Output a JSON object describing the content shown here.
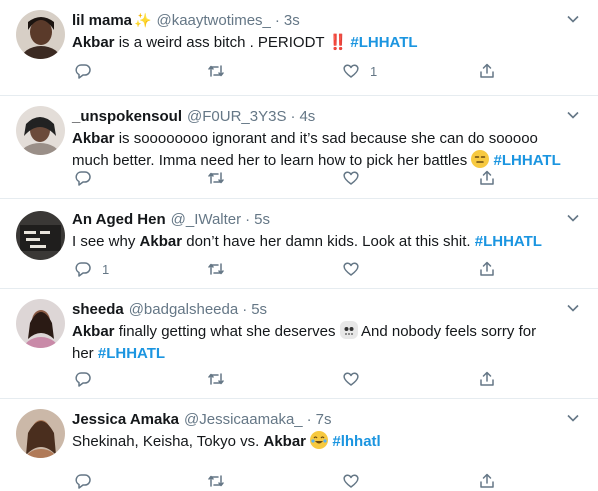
{
  "tweets": [
    {
      "name": "lil mama",
      "handle": "@kaaytwotimes_",
      "dot": "·",
      "time": "3s",
      "mention": "Akbar",
      "text_lines": [
        " is a weird ass bitch . PERIODT "
      ],
      "hashtag": "#LHHATL",
      "reply_count": "",
      "like_count": "1"
    },
    {
      "name": "_unspokensoul",
      "handle": "@F0UR_3Y3S",
      "dot": "·",
      "time": "4s",
      "mention": "Akbar",
      "text_lines": [
        " is soooooooo ignorant and it’s sad because she can do sooooo",
        "much better. Imma need her to learn how to pick her battles "
      ],
      "hashtag": "#LHHATL",
      "reply_count": "",
      "like_count": ""
    },
    {
      "name": "An Aged Hen",
      "handle": "@_IWalter",
      "dot": "·",
      "time": "5s",
      "text_pre": "I see why ",
      "mention": "Akbar",
      "text_lines": [
        " don’t have her damn kids. Look at this shit. "
      ],
      "hashtag": "#LHHATL",
      "reply_count": "1",
      "like_count": ""
    },
    {
      "name": "sheeda",
      "handle": "@badgalsheeda",
      "dot": "·",
      "time": "5s",
      "mention": "Akbar",
      "text_lines": [
        " finally getting what she deserves ",
        " And nobody feels sorry for",
        "her "
      ],
      "hashtag": "#LHHATL",
      "reply_count": "",
      "like_count": ""
    },
    {
      "name": "Jessica Amaka",
      "handle": "@Jessicaamaka_",
      "dot": "·",
      "time": "7s",
      "text_pre": "Shekinah, Keisha, Tokyo vs. ",
      "mention": "Akbar",
      "text_lines": [
        " "
      ],
      "hashtag": "#lhhatl",
      "reply_count": "",
      "like_count": ""
    }
  ],
  "colors": {
    "link": "#1b95e0",
    "muted": "#657786",
    "divider": "#e6ecf0"
  }
}
